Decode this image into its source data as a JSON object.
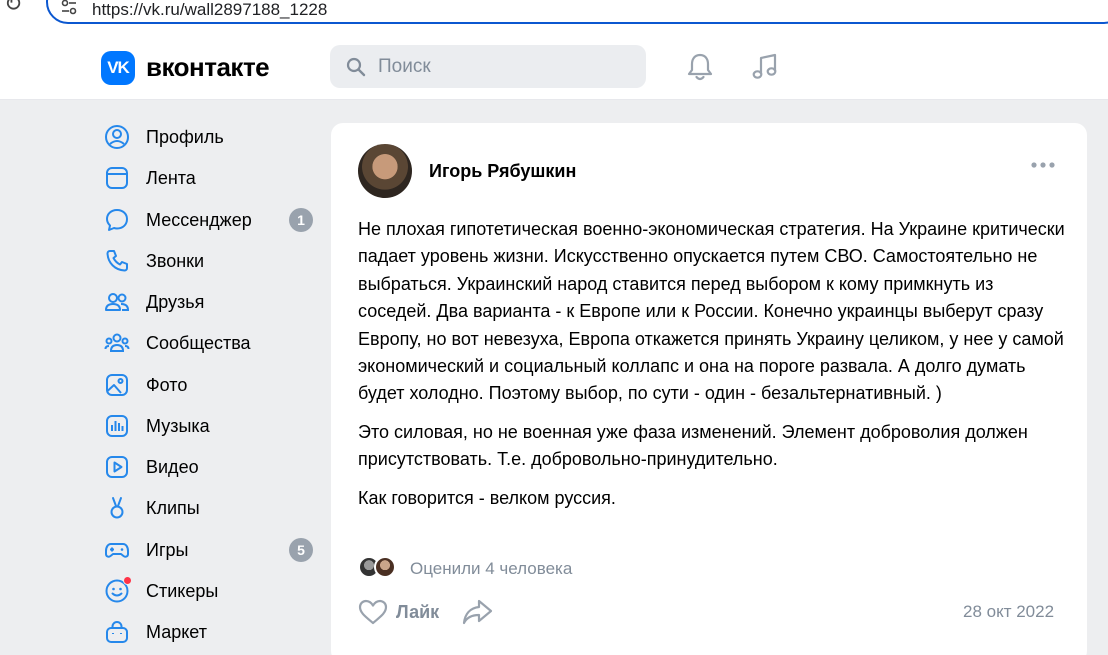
{
  "browser": {
    "url": "https://vk.ru/wall2897188_1228"
  },
  "header": {
    "logo_text": "VK",
    "brand": "вконтакте",
    "search_placeholder": "Поиск"
  },
  "sidebar": {
    "items": [
      {
        "label": "Профиль",
        "icon": "profile-icon"
      },
      {
        "label": "Лента",
        "icon": "feed-icon"
      },
      {
        "label": "Мессенджер",
        "icon": "messenger-icon",
        "badge": "1"
      },
      {
        "label": "Звонки",
        "icon": "phone-icon"
      },
      {
        "label": "Друзья",
        "icon": "friends-icon"
      },
      {
        "label": "Сообщества",
        "icon": "communities-icon"
      },
      {
        "label": "Фото",
        "icon": "photo-icon"
      },
      {
        "label": "Музыка",
        "icon": "music-icon"
      },
      {
        "label": "Видео",
        "icon": "video-icon"
      },
      {
        "label": "Клипы",
        "icon": "clips-icon"
      },
      {
        "label": "Игры",
        "icon": "games-icon",
        "badge": "5"
      },
      {
        "label": "Стикеры",
        "icon": "stickers-icon"
      },
      {
        "label": "Маркет",
        "icon": "market-icon"
      }
    ]
  },
  "post": {
    "author": "Игорь Рябушкин",
    "paragraphs": [
      "Не плохая гипотетическая военно-экономическая стратегия. На Украине критически падает уровень жизни. Искусственно опускается путем СВО. Самостоятельно не выбраться. Украинский народ ставится перед выбором к кому примкнуть из соседей. Два варианта - к Европе или к России. Конечно украинцы выберут сразу Европу, но вот невезуха, Европа откажется принять Украину целиком, у нее у самой экономический и социальный коллапс и она на пороге развала. А долго думать будет холодно. Поэтому выбор, по сути - один - безальтернативный. )",
      "Это силовая, но не военная уже фаза изменений. Элемент доброволия должен присутствовать. Т.е. добровольно-принудительно.",
      "Как говорится - велком руссия."
    ],
    "likers_text": "Оценили 4 человека",
    "like_label": "Лайк",
    "date": "28 окт 2022"
  },
  "colors": {
    "accent": "#0077ff",
    "background": "#edeef0",
    "secondary_text": "#818c99",
    "badge": "#99a2ad",
    "notification_dot": "#ff3347"
  }
}
